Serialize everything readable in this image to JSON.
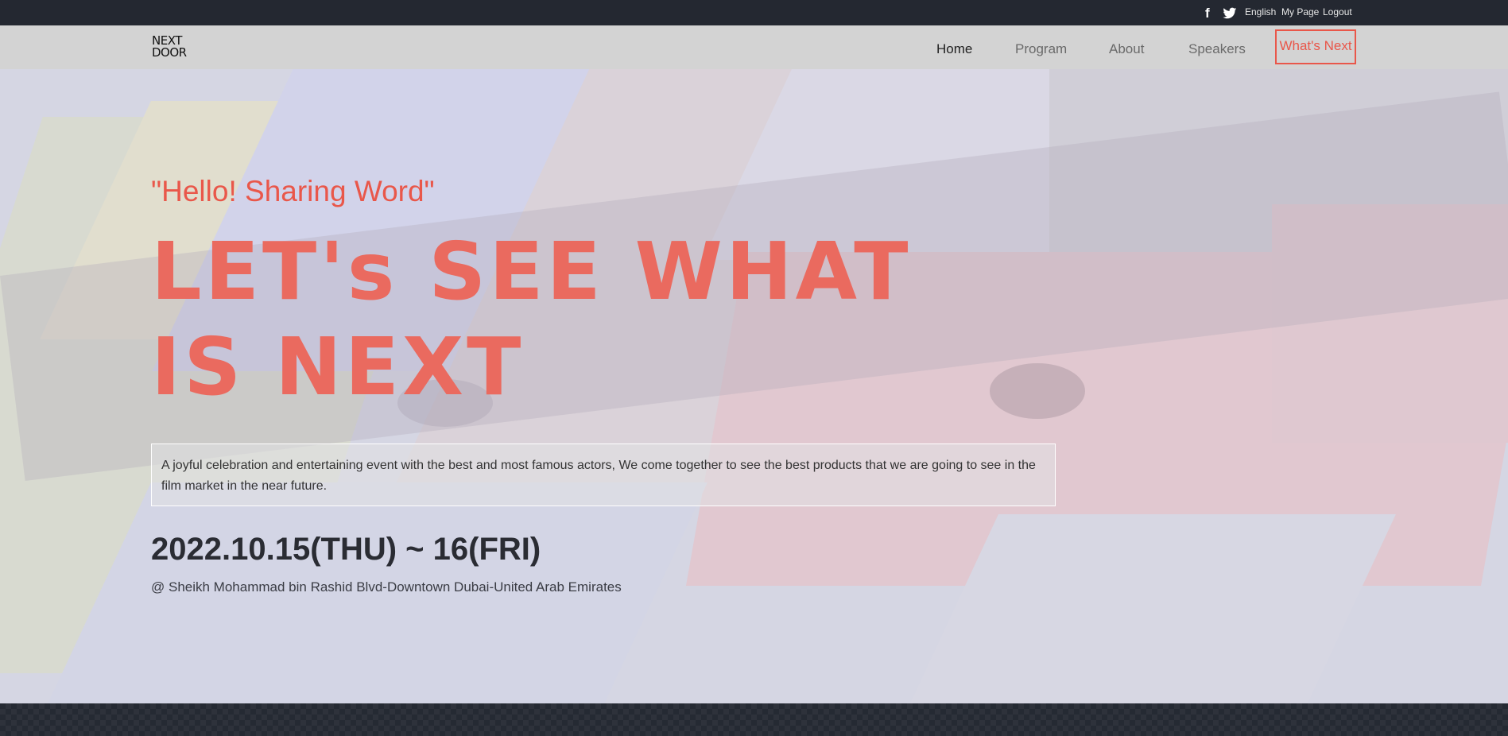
{
  "topbar": {
    "facebook_icon": "facebook-icon",
    "twitter_icon": "twitter-icon",
    "language": "English",
    "my_page": "My Page",
    "logout": "Logout"
  },
  "brand": {
    "logo_line1": "NEXT",
    "logo_line2": "DOOR"
  },
  "nav": {
    "home": "Home",
    "program": "Program",
    "about": "About",
    "speakers": "Speakers",
    "whats_next": "What's Next"
  },
  "hero": {
    "quote": "\"Hello! Sharing Word\"",
    "headline": "LET's SEE WHAT IS NEXT",
    "description": "A joyful celebration and entertaining event with the best and most famous actors, We come together to see the best products that we are going to see in the film market in the near future.",
    "date": "2022.10.15(THU) ~ 16(FRI)",
    "location": "@ Sheikh Mohammad bin Rashid Blvd-Downtown Dubai-United Arab Emirates"
  },
  "colors": {
    "accent": "#e9574a",
    "topbar_bg": "#242831",
    "nav_bg": "#d3d3d3"
  }
}
